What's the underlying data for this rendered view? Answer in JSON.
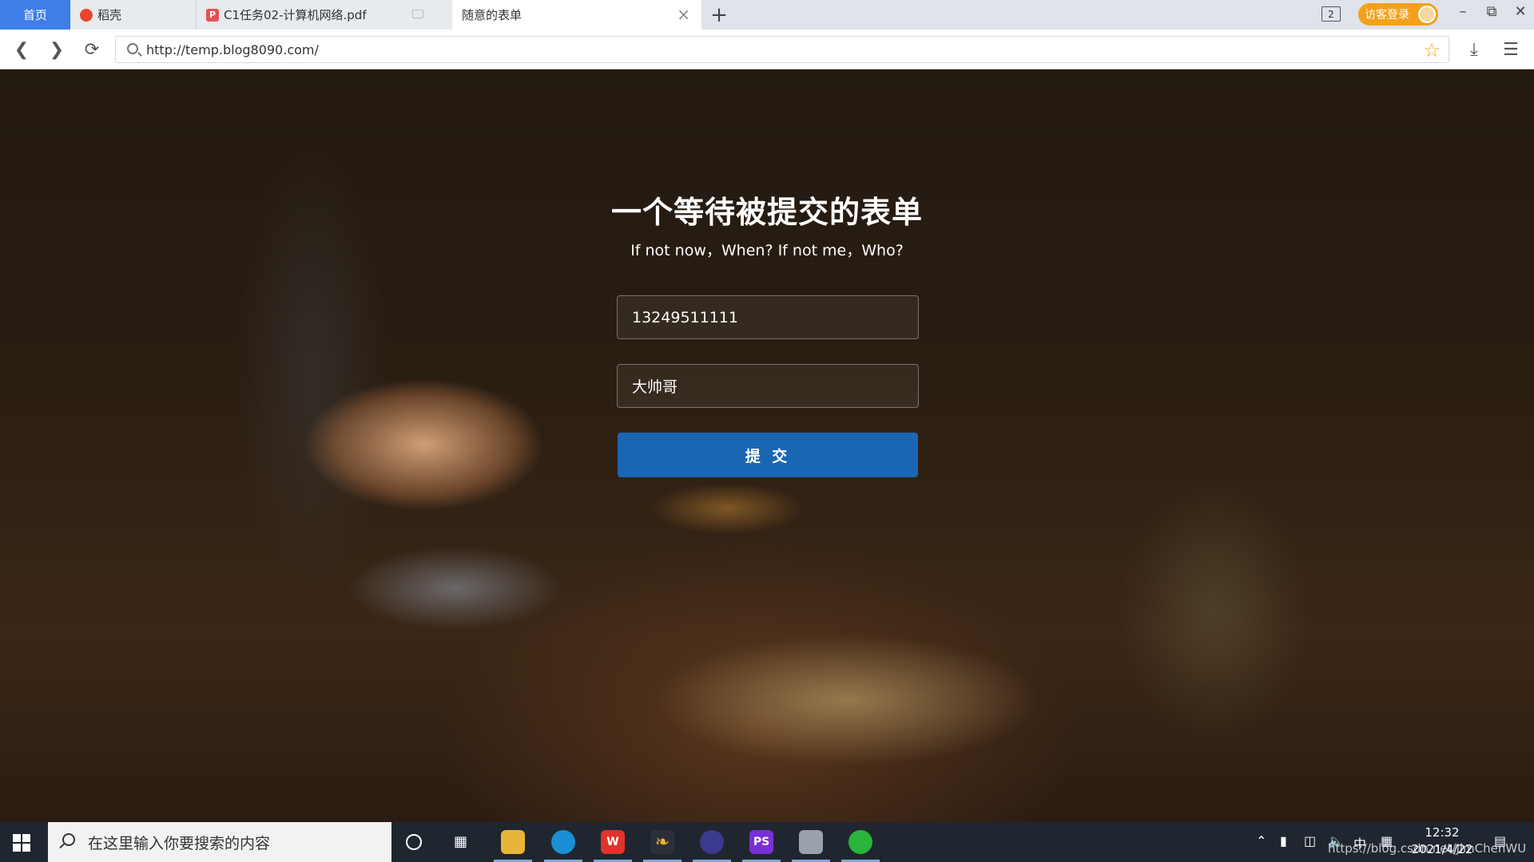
{
  "browser": {
    "tabs": {
      "home": "首页",
      "daoke": "稻壳",
      "pdf": "C1任务02-计算机网络.pdf",
      "active": "随意的表单"
    },
    "new_tab": "+",
    "tab_count": "2",
    "login_label": "访客登录",
    "url": "http://temp.blog8090.com/"
  },
  "page": {
    "title": "一个等待被提交的表单",
    "subtitle": "If not now，When? If not me，Who?",
    "phone_value": "13249511111",
    "name_value": "大帅哥",
    "submit_label": "提 交"
  },
  "taskbar": {
    "search_placeholder": "在这里输入你要搜索的内容",
    "time": "12:32",
    "date": "2021/4/22",
    "ime": "中",
    "watermark": "https://blog.csdn.net/JimChenWU"
  },
  "colors": {
    "accent_tab": "#3e7ee6",
    "submit": "#1a66b3",
    "login_pill": "#f3a11a",
    "taskbar": "#1f2630"
  }
}
